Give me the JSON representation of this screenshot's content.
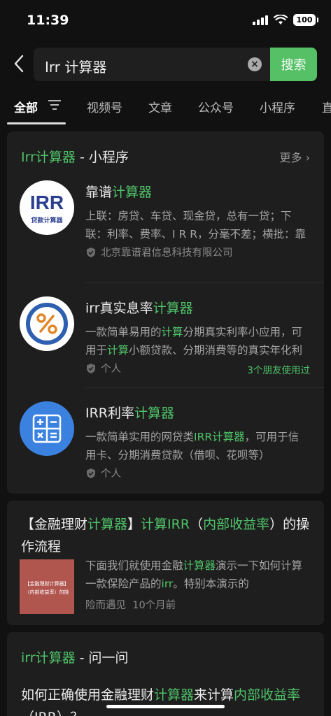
{
  "status": {
    "time": "11:39",
    "battery": "100"
  },
  "search": {
    "query": "Irr 计算器",
    "button": "搜索"
  },
  "tabs": [
    "全部",
    "视频号",
    "文章",
    "公众号",
    "小程序",
    "直"
  ],
  "miniprogram": {
    "title_hl": "Irr计算器",
    "title_rest": " - 小程序",
    "more": "更多",
    "apps": [
      {
        "name_a": "靠谱",
        "name_hl": "计算器",
        "name_b": "",
        "logo_text": "IRR",
        "logo_sub": "贷款计算器",
        "desc": "上联：房贷、车贷、现金贷，总有一贷；下联：利率、费率、I R R，分毫不差；横批：靠谱计算器",
        "owner": "北京靠谱君信息科技有限公司",
        "friends": ""
      },
      {
        "name_a": "irr真实息率",
        "name_hl": "计算器",
        "name_b": "",
        "desc_a": "一款简单易用的",
        "desc_hl1": "计算",
        "desc_b": "分期真实利率小应用，可用于",
        "desc_hl2": "计算",
        "desc_c": "小额贷款、分期消费等的真实年化利率",
        "owner": "个人",
        "friends": "3个朋友使用过"
      },
      {
        "name_a": "IRR利率",
        "name_hl": "计算器",
        "name_b": "",
        "desc_a": "一款简单实用的网贷类",
        "desc_hl1": "IRR计算器",
        "desc_b": "，可用于信用卡、分期消费贷款（借呗、花呗等）",
        "owner": "个人",
        "friends": ""
      }
    ]
  },
  "article": {
    "t1": "【金融理财",
    "t1_hl": "计算器",
    "t2": "】",
    "t2_hl": "计算IRR",
    "t3": "（",
    "t3_hl": "内部收益率",
    "t4": "）的操作流程",
    "thumb_l1": "【金融理财计算器】",
    "thumb_l2": "（内部收益率）的操",
    "d1": "下面我们就使用金融",
    "d1_hl": "计算器",
    "d2": "演示一下如何计算一款保险产品的",
    "d2_hl": "irr",
    "d3": "。特别本演示的",
    "source": "险而遇见",
    "time": "10个月前"
  },
  "qa": {
    "title_hl": "irr计算器",
    "title_rest": " - 问一问",
    "q1": "如何正确使用金融理财",
    "q1_hl": "计算器",
    "q2": "来计算",
    "q2_hl": "内部收益率",
    "q3": "（IRR）？"
  },
  "colors": {
    "accent": "#4fc369",
    "button": "#56c066",
    "card": "#1e1e1e",
    "background": "#111111"
  }
}
